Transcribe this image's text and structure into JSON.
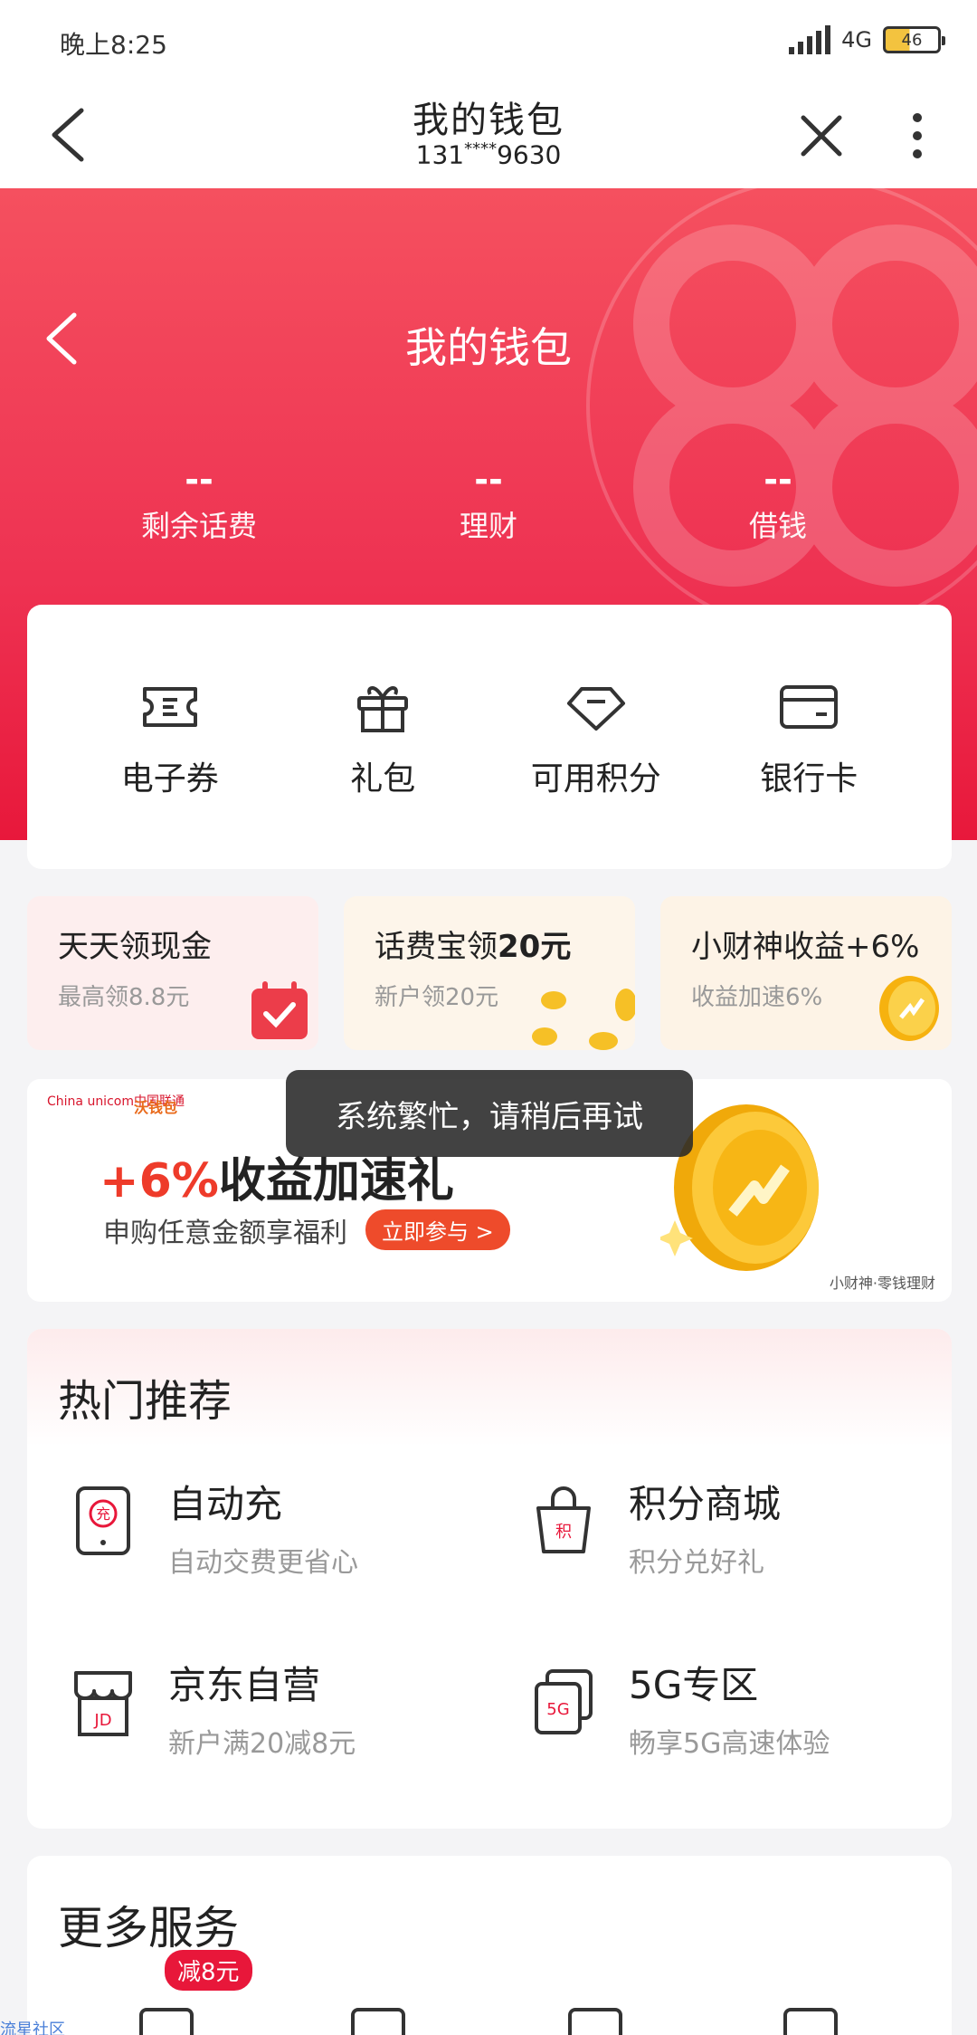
{
  "status": {
    "time": "晚上8:25",
    "network": "4G",
    "battery": "46",
    "battery_level": 0.46
  },
  "titlebar": {
    "title": "我的钱包",
    "phone_prefix": "131",
    "phone_mask": "****",
    "phone_suffix": "9630"
  },
  "hero": {
    "title": "我的钱包",
    "stats": [
      {
        "value": "--",
        "label": "剩余话费"
      },
      {
        "value": "--",
        "label": "理财"
      },
      {
        "value": "--",
        "label": "借钱"
      }
    ]
  },
  "quick": [
    {
      "label": "电子券",
      "icon": "coupon-icon"
    },
    {
      "label": "礼包",
      "icon": "gift-icon"
    },
    {
      "label": "可用积分",
      "icon": "diamond-icon"
    },
    {
      "label": "银行卡",
      "icon": "bank-card-icon"
    }
  ],
  "promos": [
    {
      "title": "天天领现金",
      "sub": "最高领8.8元"
    },
    {
      "title_pre": "话费宝领",
      "title_bold": "20元",
      "sub": "新户领20元"
    },
    {
      "title": "小财神收益+6%",
      "sub": "收益加速6%"
    }
  ],
  "banner": {
    "logo_unicom": "China unicom中国联通",
    "logo_wo": "沃钱包",
    "percent": "+6%",
    "headline": "收益加速礼",
    "desc": "申购任意金额享福利",
    "join": "立即参与 >",
    "brand": "小财神·零钱理财"
  },
  "toast": "系统繁忙，请稍后再试",
  "hot": {
    "title": "热门推荐",
    "items": [
      {
        "name": "自动充",
        "desc": "自动交费更省心",
        "icon": "auto-recharge-icon",
        "mark": "充"
      },
      {
        "name": "积分商城",
        "desc": "积分兑好礼",
        "icon": "points-mall-icon",
        "mark": "积"
      },
      {
        "name": "京东自营",
        "desc": "新户满20减8元",
        "icon": "jd-store-icon",
        "mark": "JD"
      },
      {
        "name": "5G专区",
        "desc": "畅享5G高速体验",
        "icon": "5g-zone-icon",
        "mark": "5G"
      }
    ]
  },
  "more": {
    "title": "更多服务",
    "badge": "减8元"
  },
  "watermark": "流星社区",
  "colors": {
    "brand_red": "#ee3252",
    "accent_orange": "#ee4b2b"
  }
}
